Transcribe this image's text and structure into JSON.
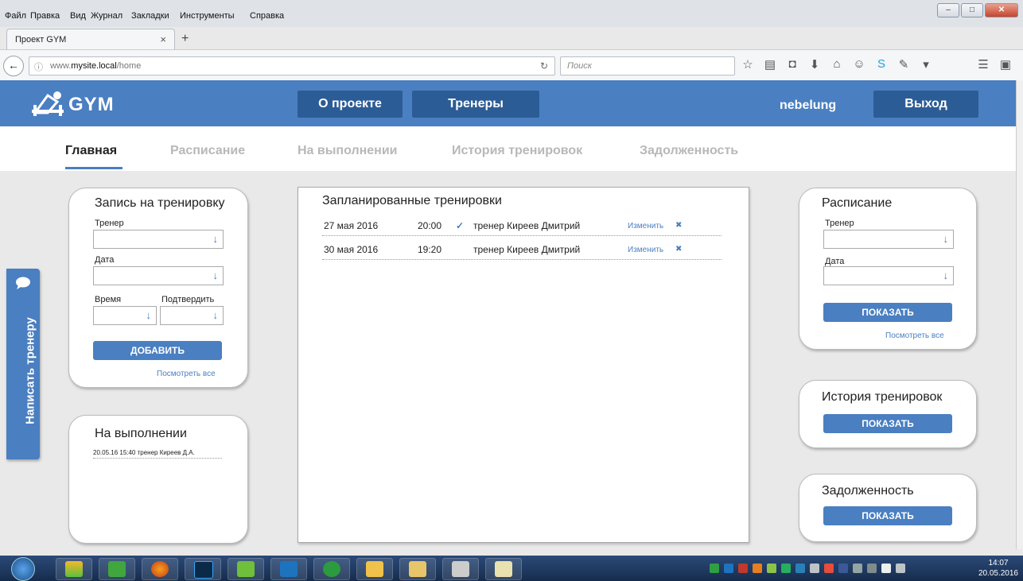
{
  "browser": {
    "menu": [
      "Файл",
      "Правка",
      "Вид",
      "Журнал",
      "Закладки",
      "Инструменты",
      "Справка"
    ],
    "tab_title": "Проект GYM",
    "url_prefix": "www.",
    "url_domain": "mysite.local",
    "url_path": "/home",
    "search_placeholder": "Поиск"
  },
  "header": {
    "logo_text": "GYM",
    "btn_about": "О проекте",
    "btn_trainers": "Тренеры",
    "username": "nebelung",
    "btn_logout": "Выход"
  },
  "subnav": [
    "Главная",
    "Расписание",
    "На выполнении",
    "История тренировок",
    "Задолженность"
  ],
  "feedback": {
    "label": "Написать тренеру"
  },
  "booking": {
    "title": "Запись на тренировку",
    "trainer_label": "Тренер",
    "date_label": "Дата",
    "time_label": "Время",
    "confirm_label": "Подтвердить",
    "add_button": "ДОБАВИТЬ",
    "view_all": "Посмотреть все"
  },
  "in_progress": {
    "title": "На выполнении",
    "items": [
      "20.05.16  15:40  тренер Киреев Д.А."
    ]
  },
  "planned": {
    "title": "Запланированные тренировки",
    "rows": [
      {
        "date": "27 мая 2016",
        "time": "20:00",
        "confirmed_mark": "✓",
        "trainer": "тренер  Киреев Дмитрий",
        "action": "Изменить"
      },
      {
        "date": "30 мая 2016",
        "time": "19:20",
        "confirmed_mark": "",
        "trainer": "тренер  Киреев Дмитрий",
        "action": "Изменить"
      }
    ]
  },
  "schedule": {
    "title": "Расписание",
    "trainer_label": "Тренер",
    "date_label": "Дата",
    "show_button": "ПОКАЗАТЬ",
    "view_all": "Посмотреть все"
  },
  "history": {
    "title": "История тренировок",
    "show_button": "ПОКАЗАТЬ"
  },
  "debt": {
    "title": "Задолженность",
    "show_button": "ПОКАЗАТЬ"
  },
  "taskbar": {
    "time": "14:07",
    "date": "20.05.2016"
  },
  "colors": {
    "accent": "#4a7fc1",
    "accent_dark": "#2c5c95"
  }
}
